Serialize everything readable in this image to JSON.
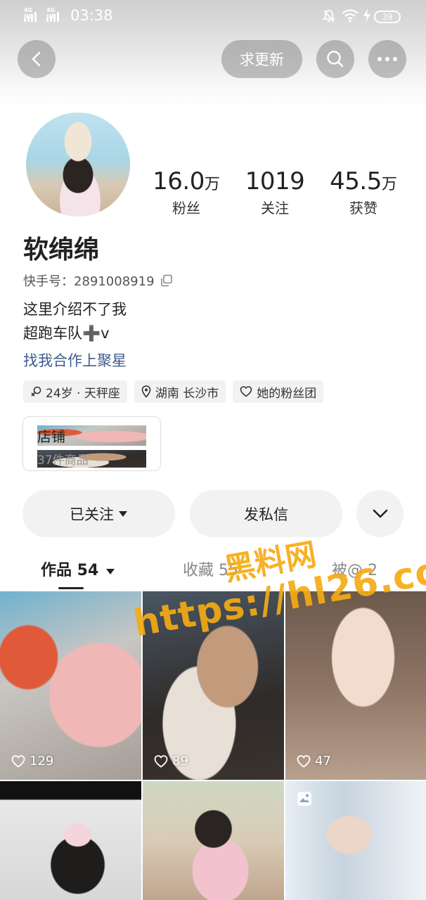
{
  "status_bar": {
    "network_1": "4G HD",
    "network_2": "4G HD",
    "time": "03:38",
    "battery": "39"
  },
  "top_bar": {
    "request_update_label": "求更新",
    "icons": [
      "back-icon",
      "search-icon",
      "more-icon"
    ]
  },
  "profile": {
    "nickname": "软绵绵",
    "uid_label": "快手号：",
    "uid": "2891008919",
    "stats": [
      {
        "number": "16.0",
        "unit": "万",
        "label": "粉丝"
      },
      {
        "number": "1019",
        "unit": "",
        "label": "关注"
      },
      {
        "number": "45.5",
        "unit": "万",
        "label": "获赞"
      }
    ],
    "bio_line1": "这里介绍不了我",
    "bio_line2": "超跑车队➕v",
    "bio_link": "找我合作上聚星",
    "tags": [
      {
        "icon": "gender-icon",
        "text": "24岁 · 天秤座"
      },
      {
        "icon": "location-icon",
        "text": "湖南 长沙市"
      },
      {
        "icon": "fan-club-icon",
        "text": "她的粉丝团"
      }
    ]
  },
  "shop": {
    "title": "店铺",
    "subtitle": "37件商品"
  },
  "actions": {
    "followed_label": "已关注",
    "message_label": "发私信"
  },
  "tabs": [
    {
      "label": "作品 54",
      "active": true
    },
    {
      "label": "收藏 55",
      "active": false
    },
    {
      "label": "被@ 2",
      "active": false
    }
  ],
  "videos": [
    {
      "likes": "129"
    },
    {
      "likes": "89"
    },
    {
      "likes": "47"
    },
    {
      "likes": ""
    },
    {
      "likes": ""
    },
    {
      "likes": ""
    }
  ],
  "watermark": {
    "line1": "黑料网",
    "line2": "https://hl26.co"
  },
  "colors": {
    "link": "#3f5c8c",
    "watermark": "#f5aa14",
    "button_bg": "#f2f2f2"
  }
}
